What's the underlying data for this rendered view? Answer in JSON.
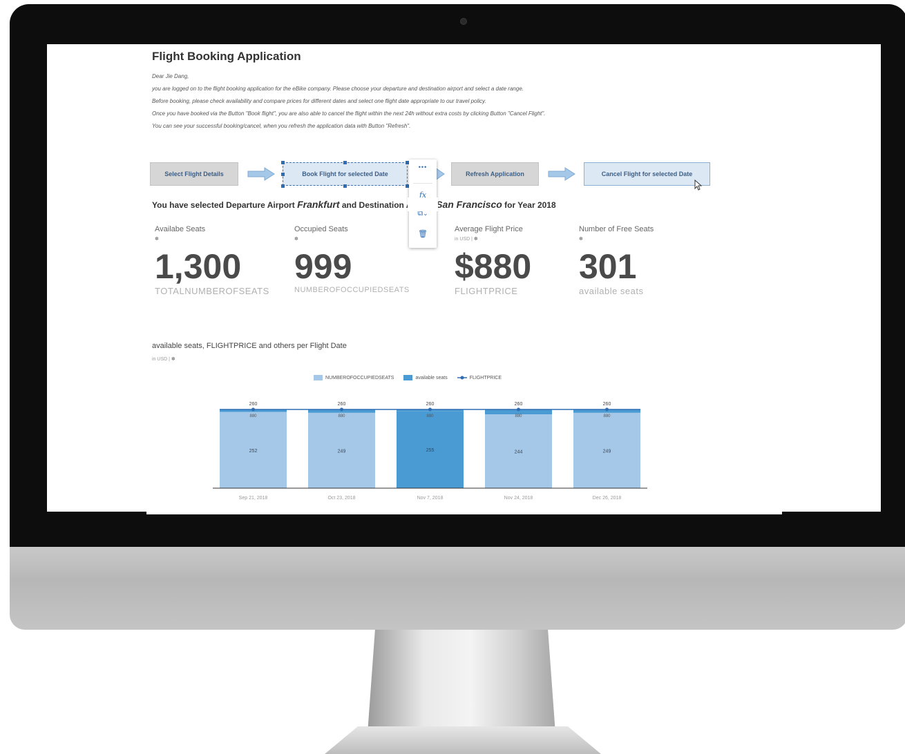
{
  "app": {
    "title": "Flight Booking Application",
    "intro": [
      "Dear Jie Dang,",
      "you are logged on to the flight booking application for the eBike company. Please choose your departure and destination airport and select a date range.",
      "Before booking, please check availability and compare prices for different dates and select one flight date appropriate to our travel policy.",
      "Once you have booked via the Button \"Book flight\", you are also able to cancel the flight within the next 24h without extra costs by clicking Button \"Cancel Flight\".",
      "You can see your successful booking/cancel, when you refresh the application data with Button \"Refresh\"."
    ]
  },
  "flow": {
    "select_label": "Select Flight Details",
    "book_label": "Book Flight for selected Date",
    "refresh_label": "Refresh Application",
    "cancel_label": "Cancel Flight for selected Date"
  },
  "context_menu": {
    "more_icon": "more-icon",
    "formula_icon": "formula-icon",
    "copy_icon": "copy-icon",
    "delete_icon": "delete-icon",
    "more_glyph": "•••",
    "formula_glyph": "fx",
    "copy_glyph": "⧉",
    "chevron_glyph": "⌄",
    "delete_glyph": "🗑"
  },
  "selection": {
    "prefix": "You have selected Departure Airport",
    "departure": "Frankfurt",
    "middle": "and Destination Airport",
    "destination": "San Francisco",
    "suffix": "for Year 2018"
  },
  "kpis": [
    {
      "label": "Availabe Seats",
      "sub": "",
      "value": "1,300",
      "unit": "TOTALNUMBEROFSEATS"
    },
    {
      "label": "Occupied Seats",
      "sub": "",
      "value": "999",
      "unit": "NUMBEROFOCCUPIEDSEATS"
    },
    {
      "label": "Average Flight Price",
      "sub": "in USD |",
      "value": "$880",
      "unit": "FLIGHTPRICE"
    },
    {
      "label": "Number of Free Seats",
      "sub": "",
      "value": "301",
      "unit": "available seats"
    }
  ],
  "chart_header": {
    "title": "available seats, FLIGHTPRICE and others per Flight Date",
    "sub": "in USD |"
  },
  "chart_data": {
    "type": "bar",
    "categories": [
      "Sep 21, 2018",
      "Oct 23, 2018",
      "Nov 7, 2018",
      "Nov 24, 2018",
      "Dec 26, 2018"
    ],
    "series": [
      {
        "name": "NUMBEROFOCCUPIEDSEATS",
        "values": [
          252,
          249,
          255,
          244,
          249
        ],
        "color": "#a6c8e8"
      },
      {
        "name": "available seats",
        "values": [
          8,
          11,
          5,
          16,
          11
        ],
        "color": "#4a9ad3"
      },
      {
        "name": "FLIGHTPRICE",
        "values": [
          880,
          880,
          880,
          880,
          880
        ],
        "color": "#2f6db3"
      }
    ],
    "top_labels": [
      "260",
      "260",
      "260",
      "260",
      "260"
    ],
    "price_labels": [
      "880",
      "880",
      "880",
      "880",
      "880"
    ],
    "highlighted_index": 2,
    "highlight_color": "#4a9ad3",
    "ylim": [
      0,
      260
    ],
    "legend_position": "top-center"
  },
  "colors": {
    "accent": "#2f6db3",
    "bar_light": "#a6c8e8",
    "bar_dark": "#4a9ad3"
  }
}
